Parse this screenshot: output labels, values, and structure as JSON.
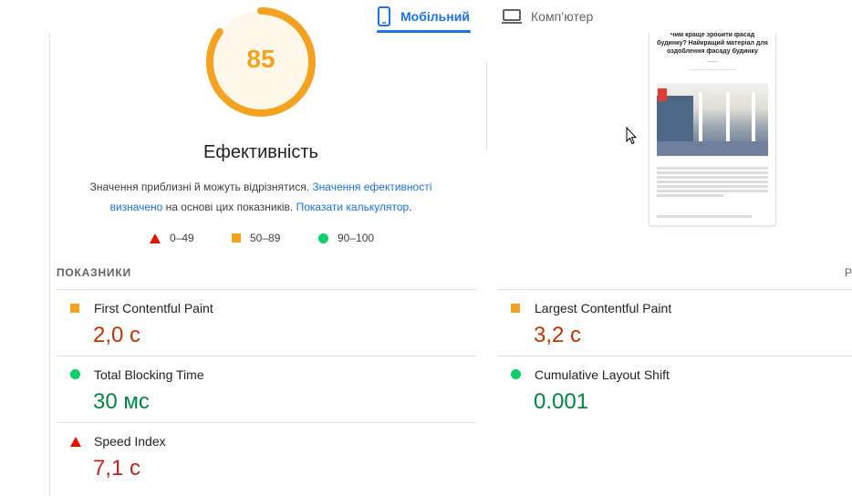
{
  "tabs": [
    {
      "label": "Мобільний",
      "icon": "smartphone-icon",
      "active": true
    },
    {
      "label": "Комп’ютер",
      "icon": "laptop-icon",
      "active": false
    }
  ],
  "score": {
    "value": "85",
    "fraction": 0.85,
    "title": "Ефективність",
    "color": "#f4a21f"
  },
  "description": {
    "text1": "Значення приблизні й можуть відрізнятися.",
    "link1": "Значення ефективності визначено",
    "text2": "на основі цих показників.",
    "link2": "Показати калькулятор",
    "text3": "."
  },
  "legend": [
    {
      "icon": "red-triangle-icon",
      "label": "0–49"
    },
    {
      "icon": "orange-square-icon",
      "label": "50–89"
    },
    {
      "icon": "green-circle-icon",
      "label": "90–100"
    }
  ],
  "preview": {
    "heading": "Чим краще зробити фасад будинку? Найкращий матеріал для оздоблення фасаду будинку"
  },
  "metrics": {
    "label": "ПОКАЗНИКИ",
    "right_label_cut": "Р",
    "items": [
      {
        "name": "First Contentful Paint",
        "value": "2,0 с",
        "status": "average"
      },
      {
        "name": "Largest Contentful Paint",
        "value": "3,2 с",
        "status": "average"
      },
      {
        "name": "Total Blocking Time",
        "value": "30 мс",
        "status": "good"
      },
      {
        "name": "Cumulative Layout Shift",
        "value": "0.001",
        "status": "good"
      },
      {
        "name": "Speed Index",
        "value": "7,1 с",
        "status": "poor"
      }
    ]
  },
  "colors": {
    "accent": "#1a73e8",
    "average": "#f4a21f",
    "good": "#0cce6b",
    "poor": "#eb0f00"
  }
}
